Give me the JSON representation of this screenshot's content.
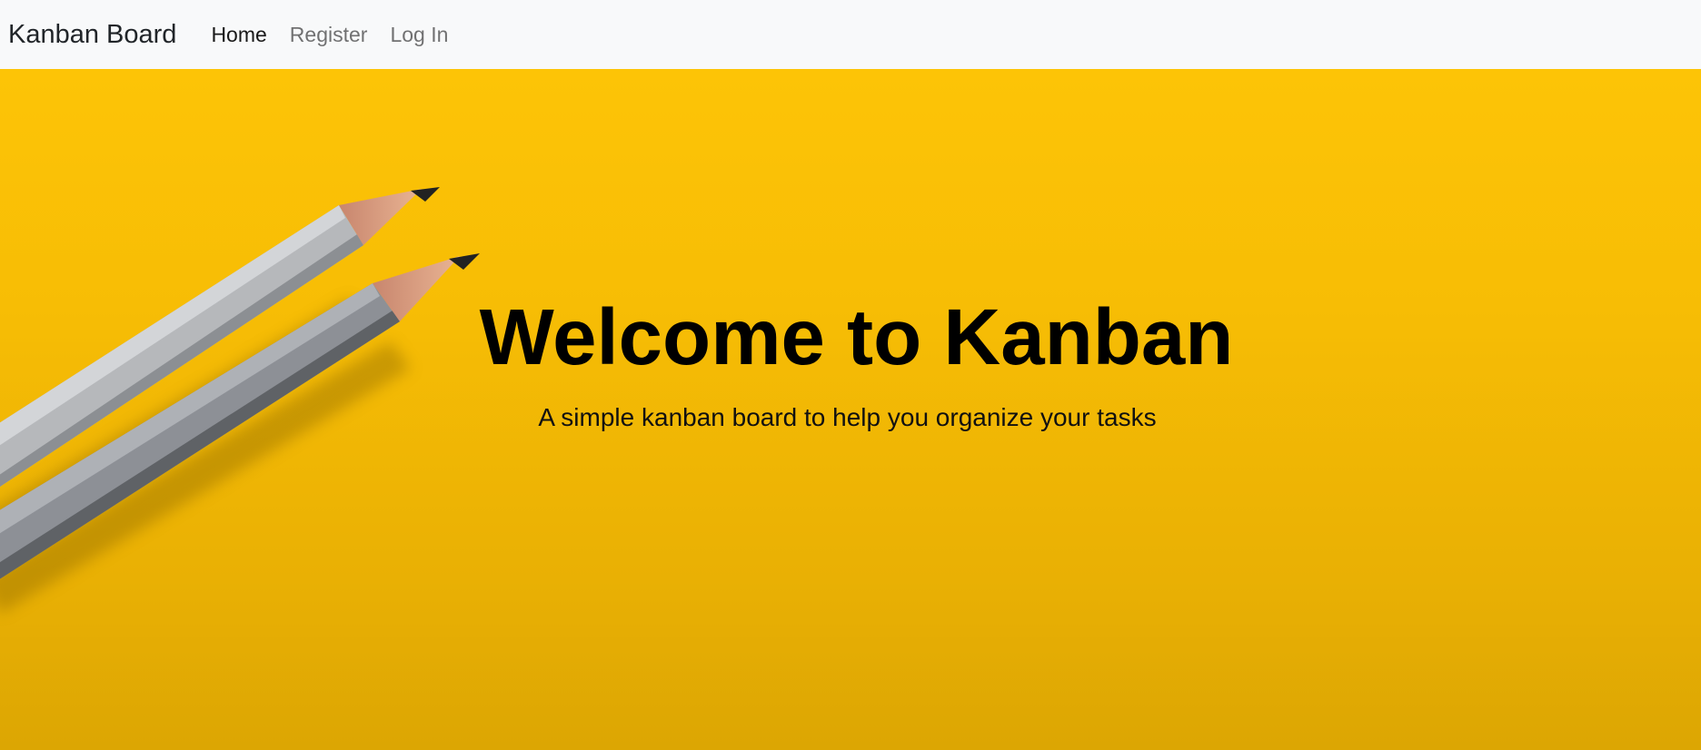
{
  "navbar": {
    "brand": "Kanban Board",
    "links": [
      {
        "label": "Home",
        "active": true
      },
      {
        "label": "Register",
        "active": false
      },
      {
        "label": "Log In",
        "active": false
      }
    ]
  },
  "hero": {
    "title": "Welcome to Kanban",
    "subtitle": "A simple kanban board to help you organize your tasks",
    "background_color": "#f7bd05",
    "image": "two-pencils-on-yellow-paper"
  }
}
